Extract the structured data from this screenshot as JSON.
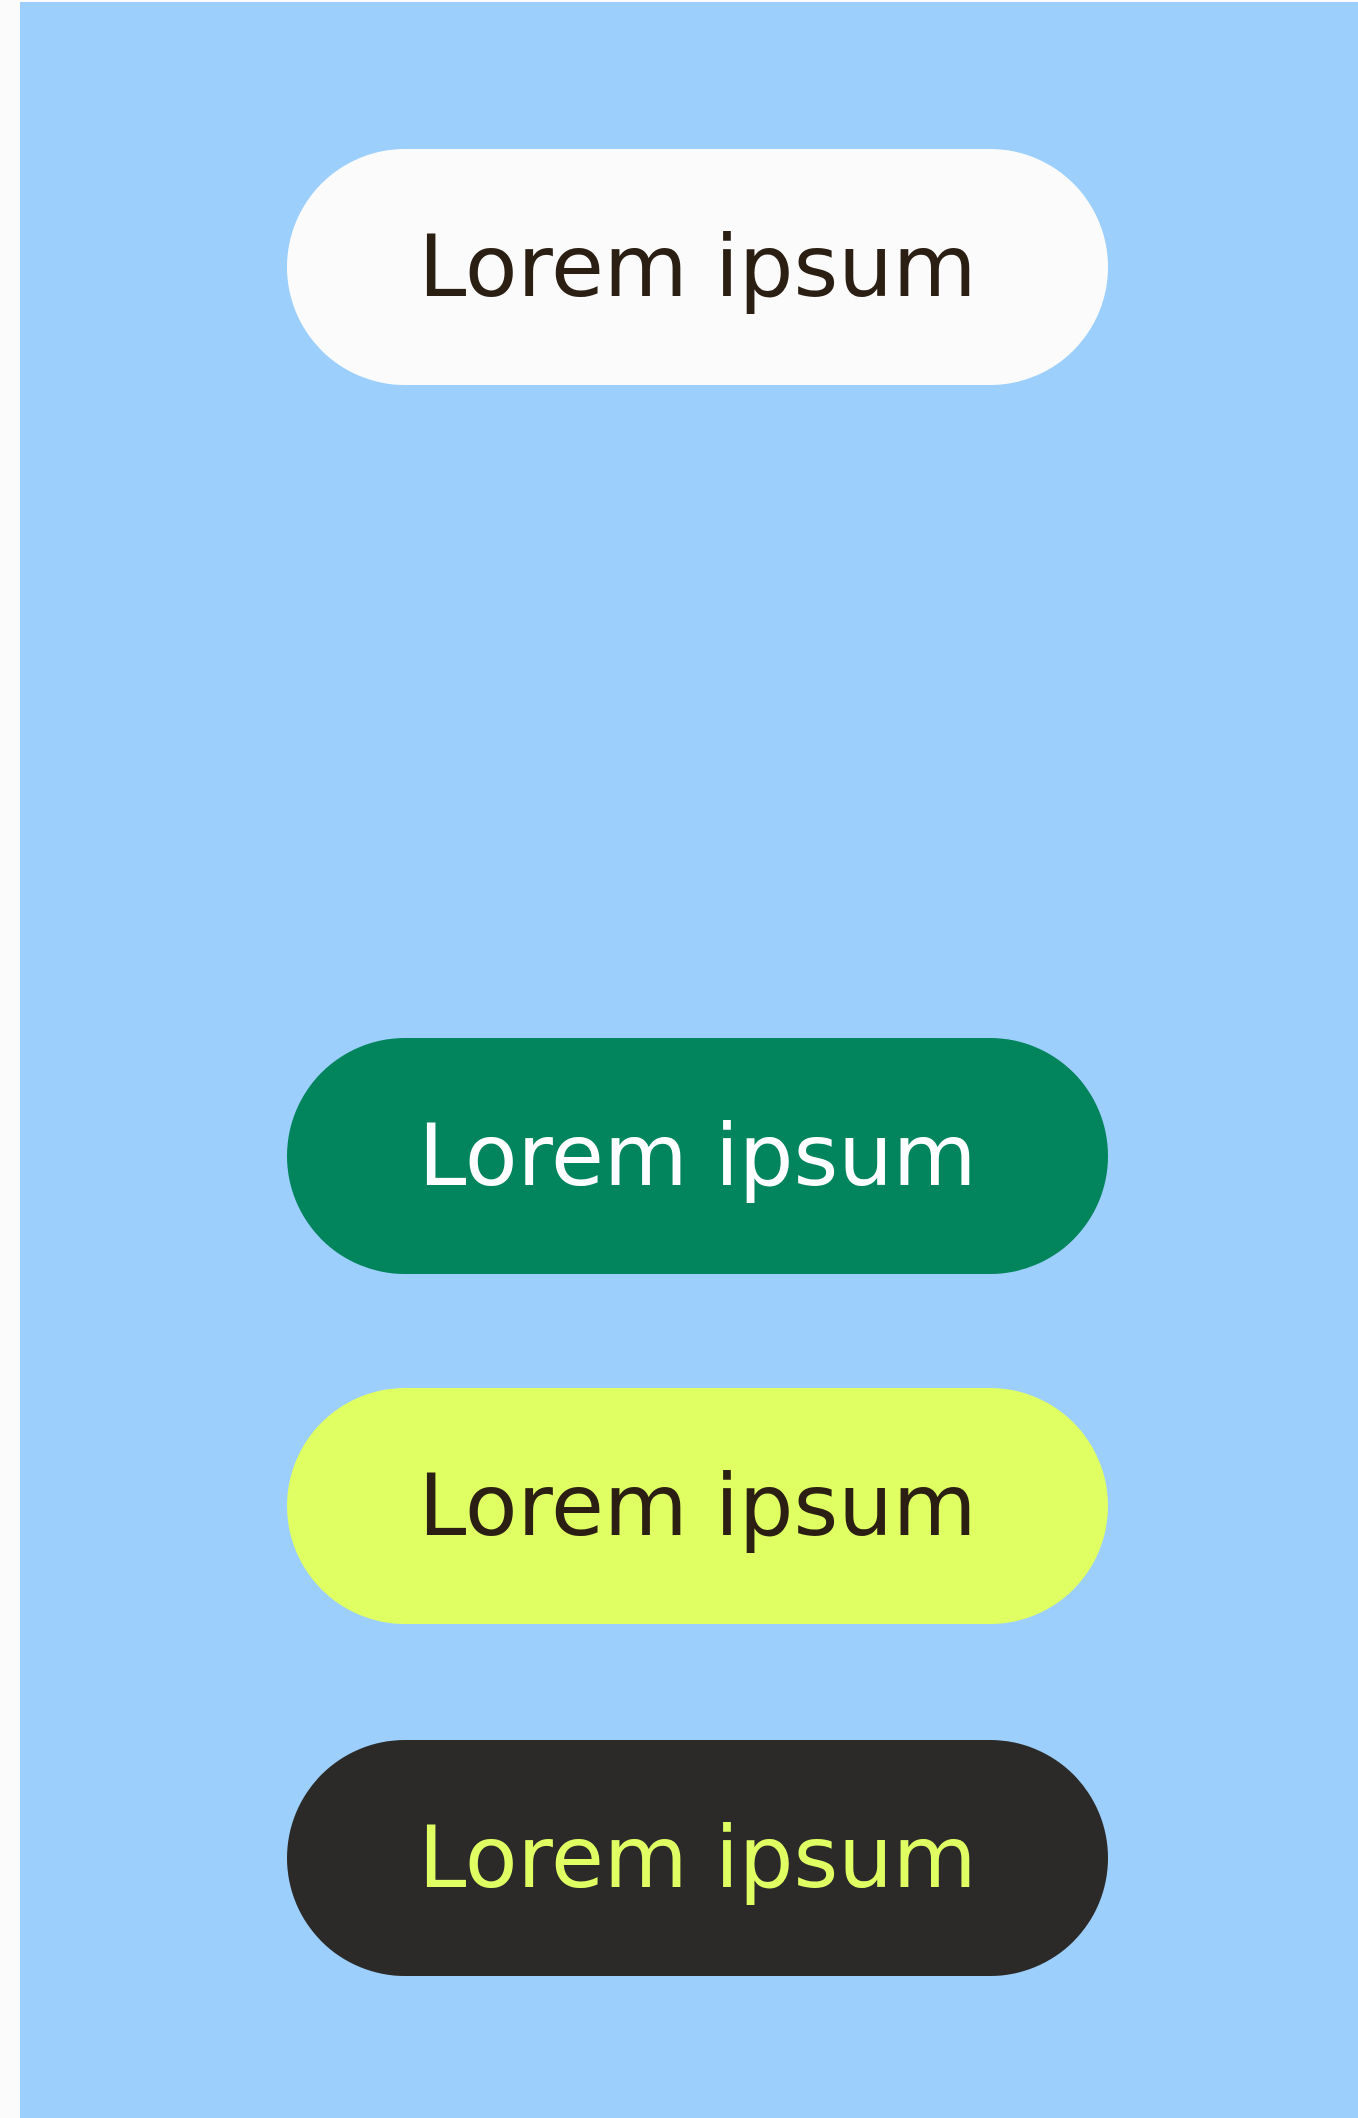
{
  "colors": {
    "page_background": "#fbfbfb",
    "canvas_background": "#9ccffc"
  },
  "buttons": [
    {
      "label": "Lorem ipsum",
      "background": "#fbfbfb",
      "text_color": "#2b1e12"
    },
    {
      "label": "Lorem ipsum",
      "background": "#02845c",
      "text_color": "#ffffff"
    },
    {
      "label": "Lorem ipsum",
      "background": "#dfff63",
      "text_color": "#2b1e12"
    },
    {
      "label": "Lorem ipsum",
      "background": "#2b2a28",
      "text_color": "#dfff63"
    }
  ]
}
